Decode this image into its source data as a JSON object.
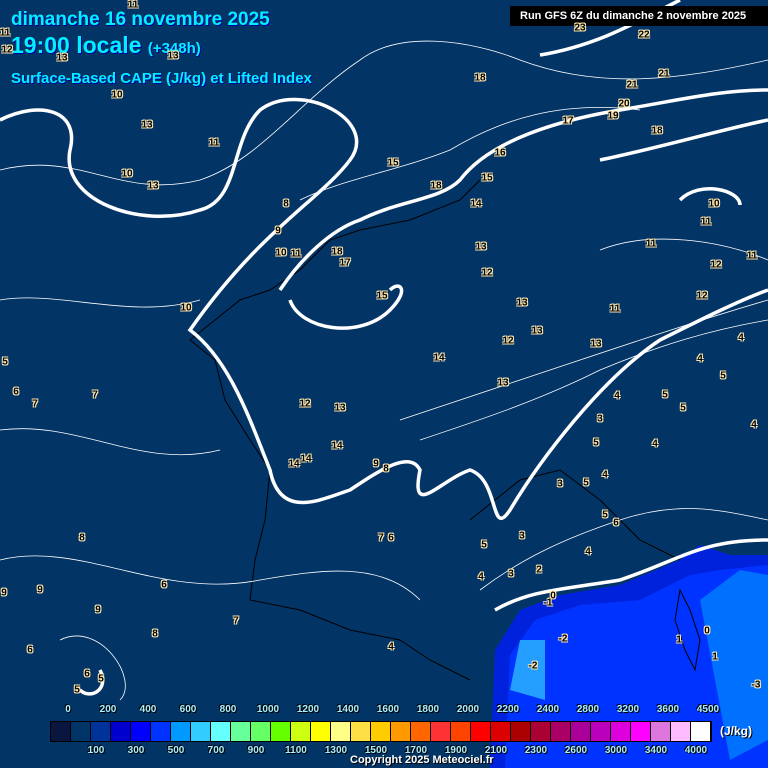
{
  "header": {
    "date": "dimanche 16 novembre 2025",
    "time": "19:00 locale",
    "lead": "(+348h)",
    "parameter": "Surface-Based CAPE (J/kg) et Lifted Index",
    "run": "Run GFS 6Z du dimanche 2 novembre 2025"
  },
  "contour_labels": [
    "11",
    "11",
    "12",
    "13",
    "13",
    "10",
    "23",
    "22",
    "18",
    "21",
    "21",
    "20",
    "19",
    "17",
    "18",
    "13",
    "11",
    "16",
    "15",
    "15",
    "18",
    "10",
    "13",
    "8",
    "14",
    "10",
    "11",
    "9",
    "10",
    "11",
    "18",
    "17",
    "13",
    "11",
    "11",
    "12",
    "12",
    "15",
    "12",
    "10",
    "13",
    "11",
    "13",
    "12",
    "13",
    "4",
    "5",
    "14",
    "4",
    "6",
    "7",
    "7",
    "13",
    "5",
    "5",
    "12",
    "13",
    "5",
    "4",
    "3",
    "4",
    "5",
    "4",
    "14",
    "14",
    "14",
    "9",
    "8",
    "3",
    "5",
    "4",
    "5",
    "6",
    "5",
    "3",
    "7",
    "6",
    "8",
    "4",
    "2",
    "3",
    "4",
    "6",
    "9",
    "9",
    "0",
    "-1",
    "9",
    "7",
    "8",
    "1",
    "0",
    "-2",
    "6",
    "4",
    "-2",
    "1",
    "6",
    "5",
    "5",
    "-3"
  ],
  "legend": {
    "colors": [
      "#0a1540",
      "#003366",
      "#003399",
      "#0000cc",
      "#0000ff",
      "#0033ff",
      "#0099ff",
      "#33ccff",
      "#66ffff",
      "#66ff99",
      "#66ff66",
      "#66ff00",
      "#ccff11",
      "#ffff00",
      "#ffff88",
      "#ffe044",
      "#ffcc00",
      "#ff9900",
      "#ff6600",
      "#ff3333",
      "#ff4400",
      "#ff0000",
      "#dd0000",
      "#aa0000",
      "#aa0033",
      "#aa0066",
      "#aa0099",
      "#bb00bb",
      "#dd00dd",
      "#ff00ff",
      "#dd77dd",
      "#ffbbff",
      "#ffffff"
    ],
    "top_ticks": [
      "0",
      "200",
      "400",
      "600",
      "800",
      "1000",
      "1200",
      "1400",
      "1600",
      "1800",
      "2000",
      "2200",
      "2400",
      "2800",
      "3200",
      "3600",
      "4500"
    ],
    "bottom_ticks": [
      "100",
      "300",
      "500",
      "700",
      "900",
      "1100",
      "1300",
      "1500",
      "1700",
      "1900",
      "2100",
      "2300",
      "2600",
      "3000",
      "3400",
      "4000"
    ],
    "unit": "(J/kg)"
  },
  "copyright": "Copyright 2025 Meteociel.fr"
}
